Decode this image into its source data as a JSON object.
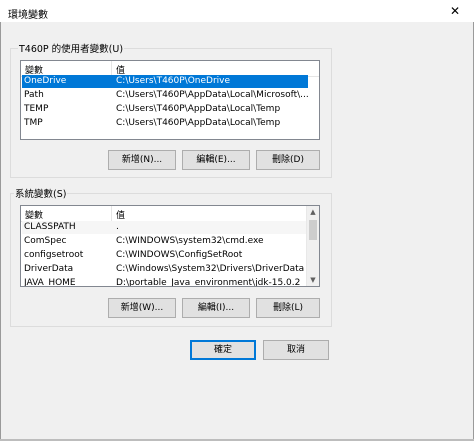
{
  "window": {
    "title": "環境變數",
    "close_glyph": "✕"
  },
  "user_vars": {
    "group_label": "T460P 的使用者變數(U)",
    "headers": [
      "變數",
      "值"
    ],
    "rows": [
      {
        "name": "OneDrive",
        "value": "C:\\Users\\T460P\\OneDrive",
        "selected": true
      },
      {
        "name": "Path",
        "value": "C:\\Users\\T460P\\AppData\\Local\\Microsoft\\...",
        "selected": false
      },
      {
        "name": "TEMP",
        "value": "C:\\Users\\T460P\\AppData\\Local\\Temp",
        "selected": false
      },
      {
        "name": "TMP",
        "value": "C:\\Users\\T460P\\AppData\\Local\\Temp",
        "selected": false
      }
    ],
    "buttons": {
      "new": "新增(N)...",
      "edit": "編輯(E)...",
      "delete": "刪除(D)"
    }
  },
  "system_vars": {
    "group_label": "系統變數(S)",
    "headers": [
      "變數",
      "值"
    ],
    "rows": [
      {
        "name": "CLASSPATH",
        "value": "."
      },
      {
        "name": "ComSpec",
        "value": "C:\\WINDOWS\\system32\\cmd.exe"
      },
      {
        "name": "configsetroot",
        "value": "C:\\WINDOWS\\ConfigSetRoot"
      },
      {
        "name": "DriverData",
        "value": "C:\\Windows\\System32\\Drivers\\DriverData"
      },
      {
        "name": "JAVA_HOME",
        "value": "D:\\portable_Java_environment\\jdk-15.0.2"
      }
    ],
    "buttons": {
      "new": "新增(W)...",
      "edit": "編輯(I)...",
      "delete": "刪除(L)"
    }
  },
  "dialog_buttons": {
    "ok": "確定",
    "cancel": "取消"
  },
  "colors": {
    "selection": "#0078d7",
    "dialog_bg": "#f0f0f0",
    "button_bg": "#e1e1e1"
  }
}
